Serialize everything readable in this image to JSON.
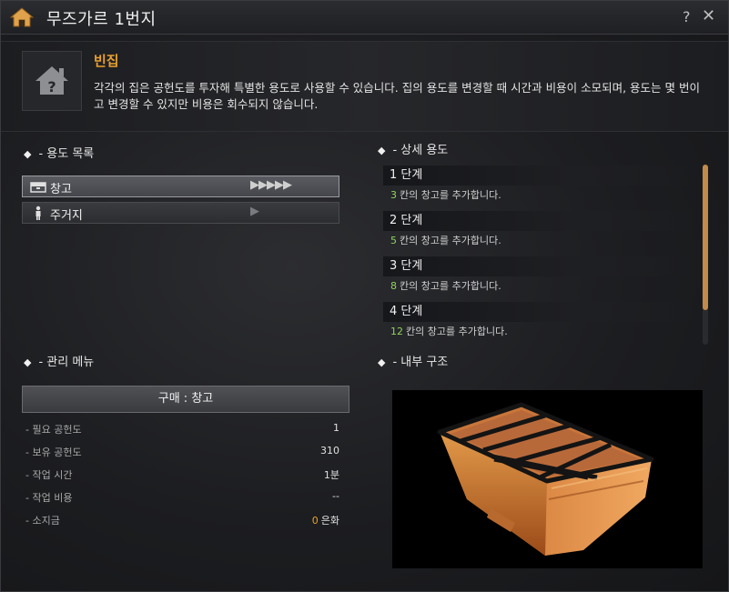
{
  "window": {
    "title": "무즈가르 1번지",
    "help_label": "?",
    "close_label": "✕"
  },
  "info": {
    "title": "빈집",
    "description": "각각의 집은 공헌도를 투자해 특별한 용도로 사용할 수 있습니다. 집의 용도를 변경할 때 시간과 비용이 소모되며, 용도는 몇 번이고 변경할 수 있지만 비용은 회수되지 않습니다."
  },
  "usage_list": {
    "header": "- 용도 목록",
    "items": [
      {
        "label": "창고",
        "arrows": "▶▶▶▶▶",
        "icon": "storage-icon",
        "selected": true
      },
      {
        "label": "주거지",
        "arrows": "▶",
        "icon": "person-icon",
        "selected": false
      }
    ]
  },
  "detail": {
    "header": "- 상세 용도",
    "stages": [
      {
        "title": "1 단계",
        "num": "3",
        "text": "칸의 창고를 추가합니다."
      },
      {
        "title": "2 단계",
        "num": "5",
        "text": "칸의 창고를 추가합니다."
      },
      {
        "title": "3 단계",
        "num": "8",
        "text": "칸의 창고를 추가합니다."
      },
      {
        "title": "4 단계",
        "num": "12",
        "text": "칸의 창고를 추가합니다."
      }
    ]
  },
  "management": {
    "header": "- 관리 메뉴",
    "buy_label": "구매 : 창고",
    "rows": [
      {
        "label": "- 필요 공헌도",
        "value": "1"
      },
      {
        "label": "- 보유 공헌도",
        "value": "310"
      },
      {
        "label": "- 작업 시간",
        "value": "1분"
      },
      {
        "label": "- 작업 비용",
        "value": "--"
      },
      {
        "label": "- 소지금",
        "gold": "0",
        "value": "은화"
      }
    ]
  },
  "interior": {
    "header": "- 내부 구조"
  },
  "colors": {
    "accent_orange": "#e8a030",
    "number_green": "#8fd35a",
    "scroll_thumb": "#c38a4a"
  }
}
